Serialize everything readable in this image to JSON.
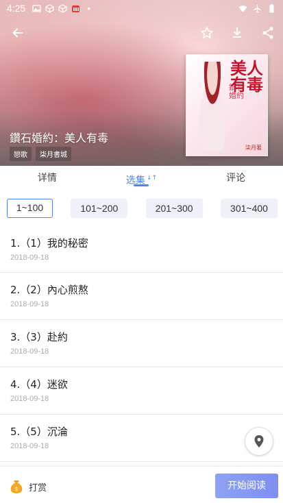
{
  "status_bar": {
    "time": "4:25"
  },
  "book": {
    "title": "鑽石婚約：美人有毒",
    "tags": [
      "戀歌",
      "柒月書城"
    ],
    "cover": {
      "big_title": "美人有毒",
      "subtitle": "鑽石婚約",
      "author": "柒月著"
    }
  },
  "tabs": [
    {
      "label": "详情",
      "active": false
    },
    {
      "label": "选集",
      "active": true,
      "sort_mark": "↓↑"
    },
    {
      "label": "评论",
      "active": false
    }
  ],
  "ranges": [
    "1~100",
    "101~200",
    "201~300",
    "301~400"
  ],
  "chapters": [
    {
      "title": "1.（1）我的秘密",
      "date": "2018-09-18"
    },
    {
      "title": "2.（2）內心煎熬",
      "date": "2018-09-18"
    },
    {
      "title": "3.（3）赴約",
      "date": "2018-09-18"
    },
    {
      "title": "4.（4）迷欲",
      "date": "2018-09-18"
    },
    {
      "title": "5.（5）沉淪",
      "date": "2018-09-18"
    }
  ],
  "bottom": {
    "tip_label": "打赏",
    "read_label": "开始阅读"
  },
  "colors": {
    "accent": "#4d86f0",
    "read_button": "#8596f3"
  }
}
